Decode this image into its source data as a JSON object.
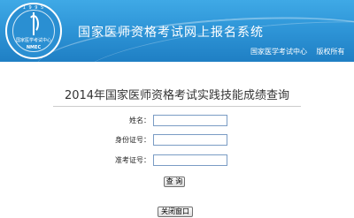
{
  "header": {
    "logo": {
      "year": "1 9 9 5",
      "org": "国家医学考试中心",
      "abbr": "NMEC"
    },
    "site_title": "国家医师资格考试网上报名系统",
    "links": [
      "国家医学考试中心",
      "版权所有"
    ],
    "colors": {
      "banner_top": "#3fa9e6",
      "banner_bottom": "#1f7fc4"
    }
  },
  "main": {
    "page_title": "2014年国家医师资格考试实践技能成绩查询",
    "form": {
      "name_label": "姓名：",
      "name_value": "",
      "id_label": "身份证号：",
      "id_value": "",
      "ticket_label": "准考证号：",
      "ticket_value": ""
    },
    "query_button": "查 询",
    "close_button": "关闭窗口"
  }
}
